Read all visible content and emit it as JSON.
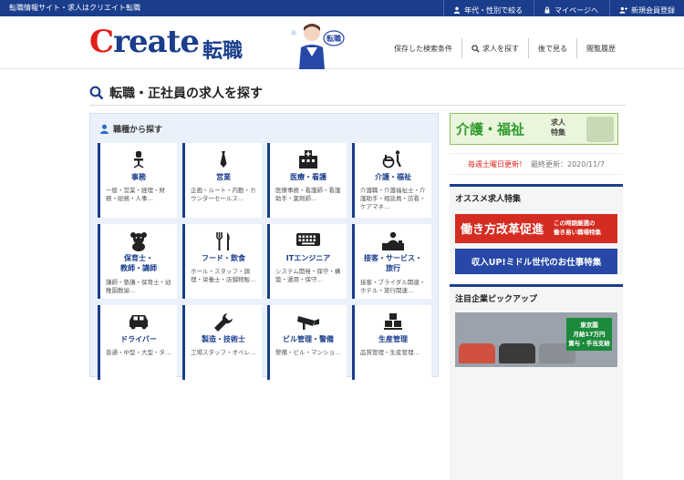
{
  "topbar": {
    "tagline": "転職情報サイト・求人はクリエイト転職",
    "nav": [
      {
        "label": "年代・性別で絞る",
        "icon": "person-icon"
      },
      {
        "label": "マイページへ",
        "icon": "lock-icon"
      },
      {
        "label": "新規会員登録",
        "icon": "user-plus-icon"
      }
    ]
  },
  "header": {
    "logo_main": "Create",
    "logo_sub": "転職",
    "mascot_badge": "転職",
    "nav": [
      {
        "label": "保存した検索条件"
      },
      {
        "label": "求人を探す",
        "icon": "search-icon"
      },
      {
        "label": "後で見る"
      },
      {
        "label": "閲覧履歴"
      }
    ]
  },
  "page_title": "転職・正社員の求人を探す",
  "panel": {
    "title": "職種から探す",
    "categories": [
      {
        "name": "事務",
        "desc": "一般・営業・経理・財務・総務・人事…",
        "icon": "office-chair-icon"
      },
      {
        "name": "営業",
        "desc": "企画・ルート・内勤・カウンターセールス…",
        "icon": "necktie-icon"
      },
      {
        "name": "医療・看護",
        "desc": "医療事務・看護師・看護助手・薬剤師…",
        "icon": "hospital-icon"
      },
      {
        "name": "介護・福祉",
        "desc": "介護職・介護福祉士・介護助手・相談員・訪看・ケアマネ…",
        "icon": "wheelchair-icon"
      },
      {
        "name": "保育士・\n教師・講師",
        "desc": "講師・塾講・保育士・幼稚園教諭…",
        "icon": "teddy-bear-icon"
      },
      {
        "name": "フード・飲食",
        "desc": "ホール・スタッフ・調理・栄養士・店舗物販…",
        "icon": "fork-knife-icon"
      },
      {
        "name": "ITエンジニア",
        "desc": "システム開発・保守・構築・運用・保守…",
        "icon": "keyboard-icon"
      },
      {
        "name": "接客・サービス・\n旅行",
        "desc": "接客・ブライダル関連・ホテル・旅行関連…",
        "icon": "reception-icon"
      },
      {
        "name": "ドライバー",
        "desc": "普通・中型・大型・タ…",
        "icon": "car-icon"
      },
      {
        "name": "製造・技術士",
        "desc": "工場スタッフ・オペレ…",
        "icon": "wrench-icon"
      },
      {
        "name": "ビル管理・警備",
        "desc": "警備・ビル・マンショ…",
        "icon": "cctv-camera-icon"
      },
      {
        "name": "生産管理",
        "desc": "品質管理・生産管理…",
        "icon": "boxes-icon"
      }
    ]
  },
  "sidebar": {
    "care_banner_main": "介護・福祉",
    "care_banner_sub": "求人\n特集",
    "update_label": "毎週土曜日更新！",
    "update_date": "最終更新：2020/11/7",
    "featured_title": "オススメ求人特集",
    "banner_reform_main": "働き方改革促進",
    "banner_reform_sub": "この時期厳選の\n働き易い職場特集",
    "banner_income": "収入UP!ミドル世代のお仕事特集",
    "companies_title": "注目企業ピックアップ",
    "company_sign": "東京園\n月給17万円\n賞与・手当支給"
  },
  "colors": {
    "brand_blue": "#1a3d8c",
    "accent_red": "#e0201a",
    "care_green": "#2f9a2c"
  }
}
